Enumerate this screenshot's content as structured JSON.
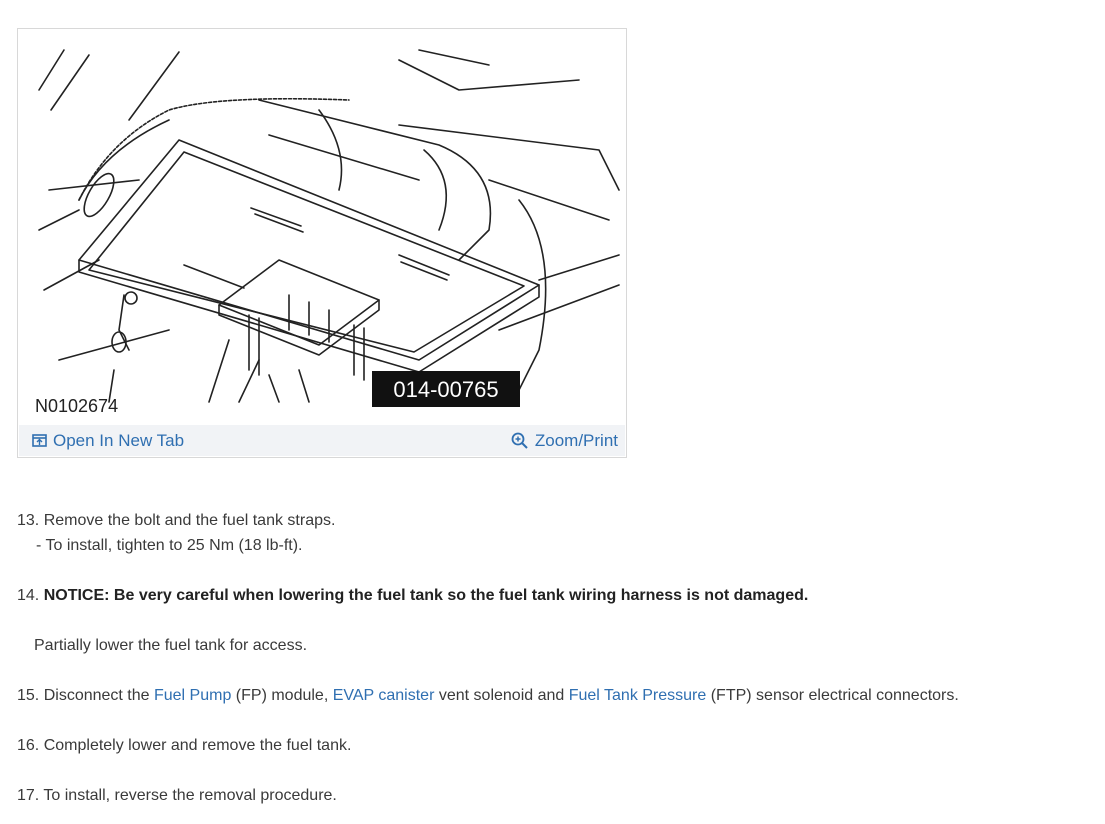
{
  "figure": {
    "ref_code": "N0102674",
    "part_code": "014-00765",
    "open_tab_label": "Open In New Tab",
    "zoom_label": "Zoom/Print"
  },
  "steps": {
    "s13": {
      "num": "13.",
      "text": "Remove the bolt and the fuel tank straps.",
      "sub": "- To install, tighten to 25 Nm (18 lb-ft)."
    },
    "s14": {
      "num": "14.",
      "notice": "NOTICE: Be very careful when lowering the fuel tank so the fuel tank wiring harness is not damaged.",
      "sub": "Partially lower the fuel tank for access."
    },
    "s15": {
      "num": "15.",
      "t1": "Disconnect the ",
      "l1": "Fuel Pump",
      "t2": " (FP) module, ",
      "l2": "EVAP canister",
      "t3": " vent solenoid and ",
      "l3": "Fuel Tank Pressure",
      "t4": " (FTP) sensor electrical connectors."
    },
    "s16": {
      "num": "16.",
      "text": "Completely lower and remove the fuel tank."
    },
    "s17": {
      "num": "17.",
      "text": "To install, reverse the removal procedure."
    }
  },
  "colors": {
    "link": "#2f6fb1",
    "text": "#3a3a3a",
    "bar_bg": "#f1f3f6"
  }
}
